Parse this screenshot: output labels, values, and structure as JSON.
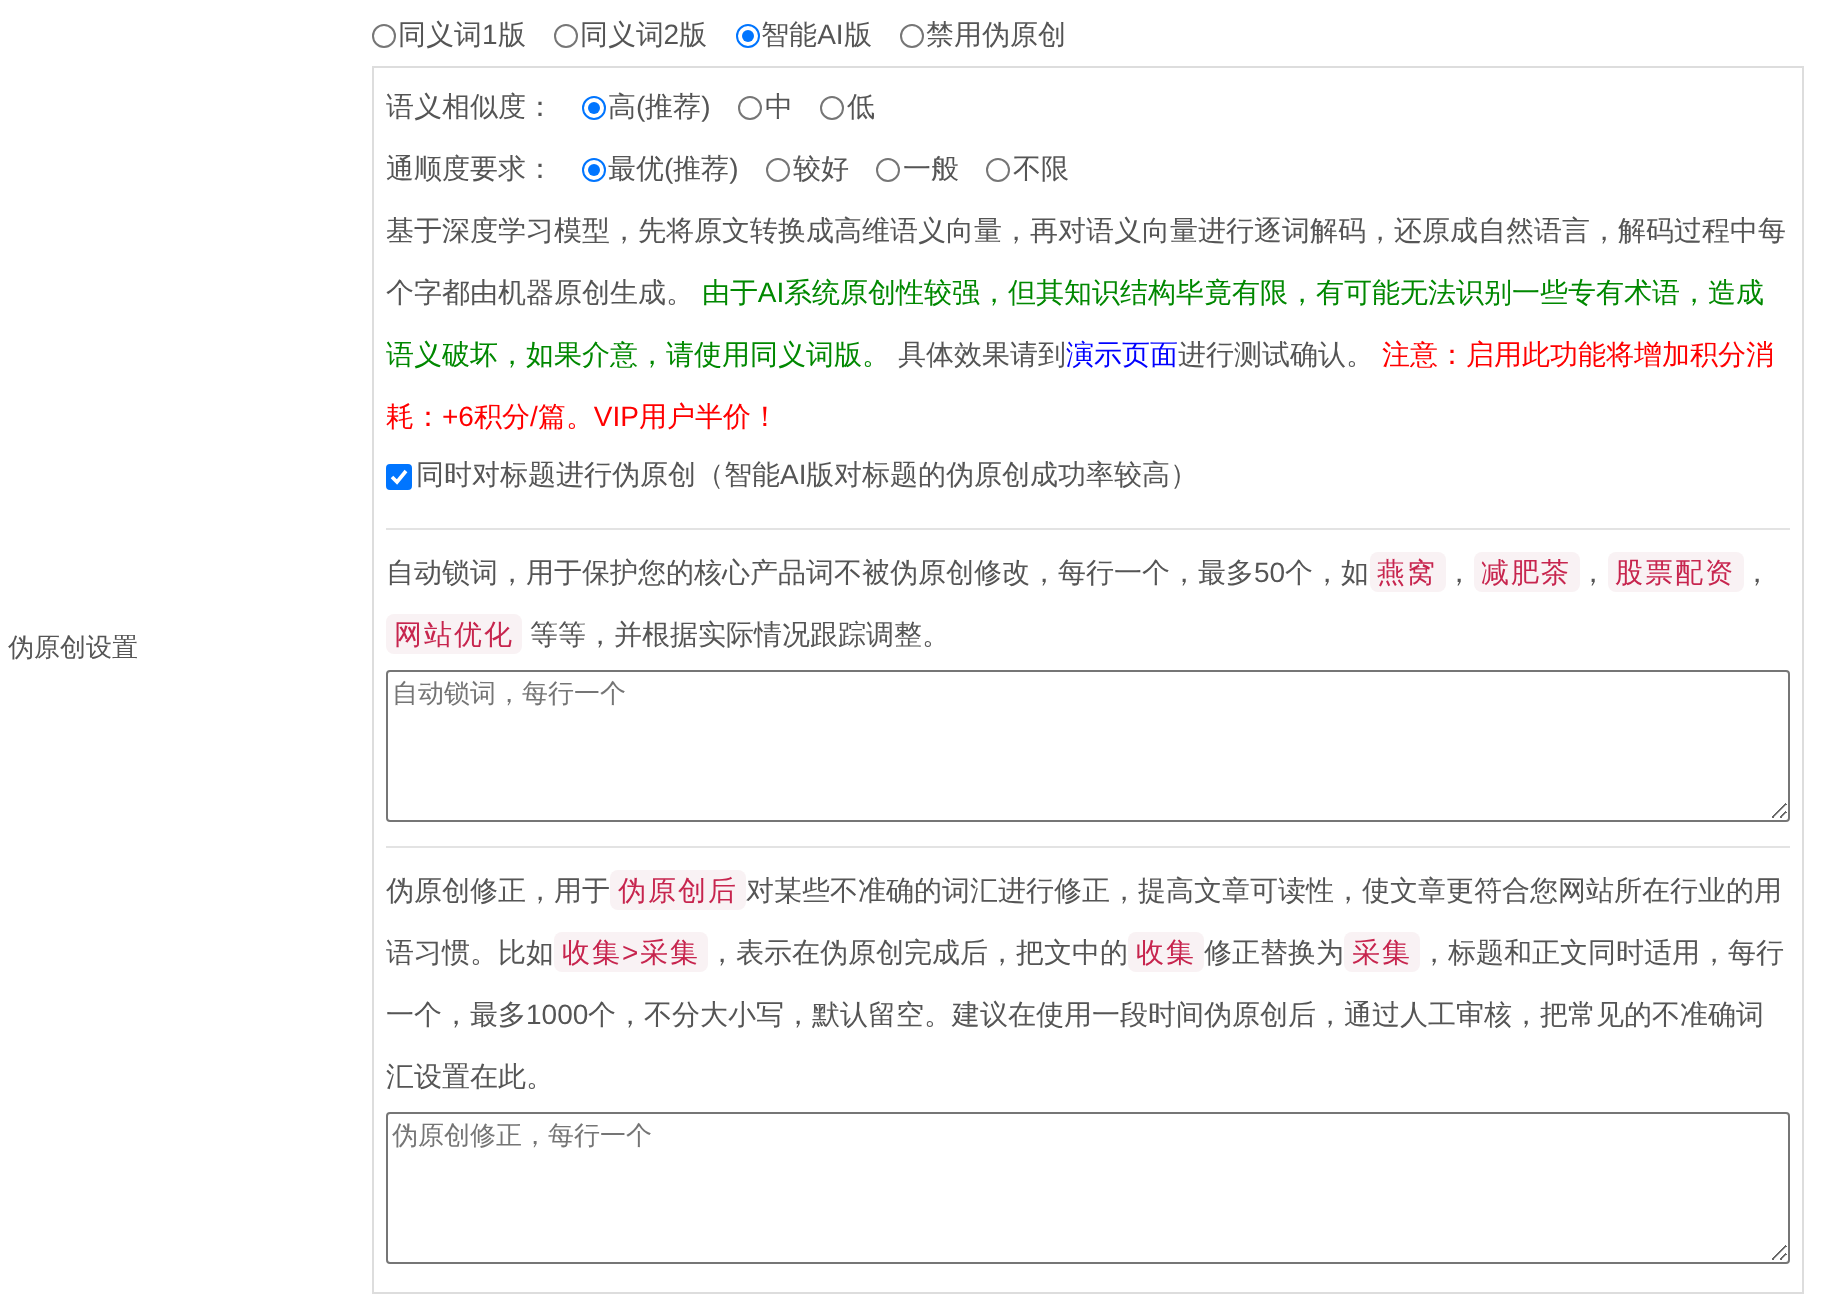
{
  "section_label": "伪原创设置",
  "modes": [
    {
      "label": "同义词1版",
      "selected": false
    },
    {
      "label": "同义词2版",
      "selected": false
    },
    {
      "label": "智能AI版",
      "selected": true
    },
    {
      "label": "禁用伪原创",
      "selected": false
    }
  ],
  "similarity": {
    "label": "语义相似度：",
    "options": [
      {
        "label": "高(推荐)",
        "selected": true
      },
      {
        "label": "中",
        "selected": false
      },
      {
        "label": "低",
        "selected": false
      }
    ]
  },
  "fluency": {
    "label": "通顺度要求：",
    "options": [
      {
        "label": "最优(推荐)",
        "selected": true
      },
      {
        "label": "较好",
        "selected": false
      },
      {
        "label": "一般",
        "selected": false
      },
      {
        "label": "不限",
        "selected": false
      }
    ]
  },
  "ai_description": [
    {
      "kind": "text",
      "text": "基于深度学习模型，先将原文转换成高维语义向量，再对语义向量进行逐词解码，还原成自然语言，解码过程中每个字都由机器原创生成。 "
    },
    {
      "kind": "notice",
      "text": "由于AI系统原创性较强，但其知识结构毕竟有限，有可能无法识别一些专有术语，造成语义破坏，如果介意，请使用同义词版。"
    },
    {
      "kind": "text",
      "text": " 具体效果请到"
    },
    {
      "kind": "link",
      "text": "演示页面"
    },
    {
      "kind": "text",
      "text": "进行测试确认。 "
    },
    {
      "kind": "warning",
      "text": "注意：启用此功能将增加积分消耗：+6积分/篇。VIP用户半价！"
    }
  ],
  "title_option": {
    "label": "同时对标题进行伪原创（智能AI版对标题的伪原创成功率较高）",
    "checked": true
  },
  "lock_words": {
    "description": [
      {
        "kind": "text",
        "text": "自动锁词，用于保护您的核心产品词不被伪原创修改，每行一个，最多50个，如"
      },
      {
        "kind": "tag",
        "text": "燕窝"
      },
      {
        "kind": "text",
        "text": "，"
      },
      {
        "kind": "tag",
        "text": "减肥茶"
      },
      {
        "kind": "text",
        "text": "，"
      },
      {
        "kind": "tag",
        "text": "股票配资"
      },
      {
        "kind": "text",
        "text": "，"
      },
      {
        "kind": "tag",
        "text": "网站优化"
      },
      {
        "kind": "text",
        "text": " 等等，并根据实际情况跟踪调整。"
      }
    ],
    "placeholder": "自动锁词，每行一个"
  },
  "correction": {
    "description": [
      {
        "kind": "text",
        "text": "伪原创修正，用于"
      },
      {
        "kind": "tag",
        "text": "伪原创后"
      },
      {
        "kind": "text",
        "text": "对某些不准确的词汇进行修正，提高文章可读性，使文章更符合您网站所在行业的用语习惯。比如"
      },
      {
        "kind": "tag",
        "text": "收集>采集"
      },
      {
        "kind": "text",
        "text": "，表示在伪原创完成后，把文中的"
      },
      {
        "kind": "tag",
        "text": "收集"
      },
      {
        "kind": "text",
        "text": "修正替换为"
      },
      {
        "kind": "tag",
        "text": "采集"
      },
      {
        "kind": "text",
        "text": "，标题和正文同时适用，每行一个，最多1000个，不分大小写，默认留空。建议在使用一段时间伪原创后，通过人工审核，把常见的不准确词汇设置在此。"
      }
    ],
    "placeholder": "伪原创修正，每行一个"
  }
}
